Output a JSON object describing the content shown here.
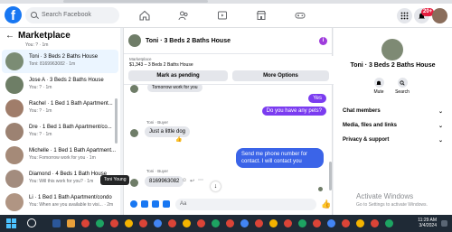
{
  "topbar": {
    "search_placeholder": "Search Facebook",
    "logo": "f",
    "notif_count": "20+"
  },
  "sidebar": {
    "title": "Marketplace",
    "first_preview": "You: ? · 1m",
    "items": [
      {
        "title": "Toni · 3 Beds 2 Baths House",
        "sub": "Toni: 8169963082 · 1m"
      },
      {
        "title": "Jose A · 3 Beds 2 Baths House",
        "sub": "You: ? · 1m"
      },
      {
        "title": "Rachel · 1 Bed 1 Bath Apartment...",
        "sub": "You: ? · 1m"
      },
      {
        "title": "Dre · 1 Bed 1 Bath Apartment/co...",
        "sub": "You: ? · 1m"
      },
      {
        "title": "Michelle · 1 Bed 1 Bath Apartment...",
        "sub": "You: Fomorrow work for you · 1m"
      },
      {
        "title": "Diamond · 4 Beds 1 Bath House",
        "sub": "You: Will this work for you? · 1m"
      },
      {
        "title": "Li · 1 Bed 1 Bath Apartment/condo",
        "sub": "You: When are you available to visi... · 2m"
      }
    ],
    "tooltip": "Toni Young"
  },
  "chat": {
    "header_name": "Toni · 3 Beds 2 Baths House",
    "listing_label": "Marketplace",
    "listing_price": "$1,343 – 3 Beds 2 Baths House",
    "mark_pending": "Mark as pending",
    "more_options": "More Options",
    "cut_message": "Tomorrow work for you",
    "yes": "Yes",
    "pets_q": "Do you have any pets?",
    "sender1": "Toni · Buyer",
    "dog": "Just a little dog",
    "send_phone": "Send me phone number for contact. I will contact you",
    "sender2": "Toni · Buyer",
    "phone": "8169963082",
    "composer_placeholder": "Aa",
    "scroll_arrow": "↓"
  },
  "right": {
    "name": "Toni · 3 Beds 2 Baths House",
    "mute": "Mute",
    "search": "Search",
    "rows": [
      "Chat members",
      "Media, files and links",
      "Privacy & support"
    ],
    "activate": "Activate Windows",
    "activate_sub": "Go to Settings to activate Windows."
  },
  "taskbar": {
    "time": "11:29 AM",
    "date": "3/4/2024"
  }
}
